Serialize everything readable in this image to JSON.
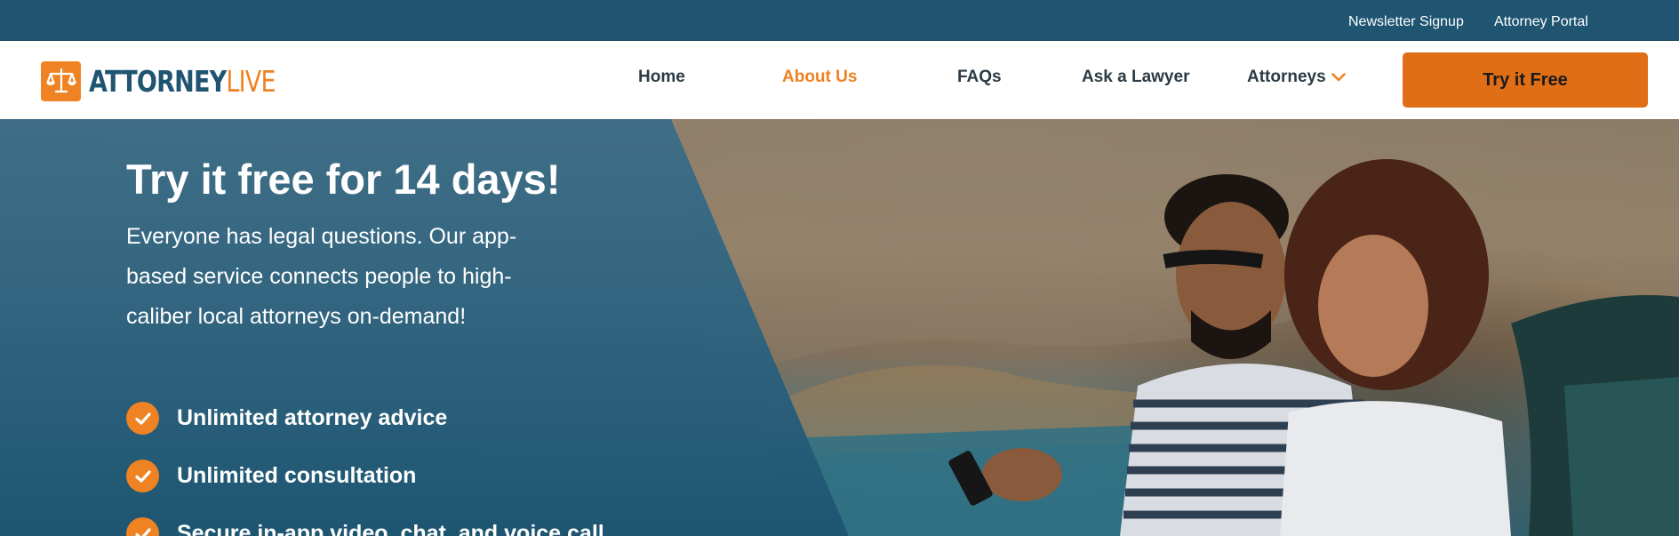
{
  "utility_nav": {
    "newsletter": "Newsletter Signup",
    "portal": "Attorney Portal"
  },
  "brand": {
    "word1": "ATTORNEY",
    "word2": "LIVE",
    "logo_icon": "scales-of-justice-icon"
  },
  "nav": {
    "home": "Home",
    "about": "About Us",
    "faqs": "FAQs",
    "ask": "Ask a Lawyer",
    "attorneys": "Attorneys",
    "active": "About Us"
  },
  "cta": {
    "label": "Try it Free"
  },
  "hero": {
    "title": "Try it free for 14 days!",
    "subtitle": "Everyone has legal questions. Our app-based service connects people to high-caliber local attorneys on-demand!",
    "features": [
      "Unlimited attorney advice",
      "Unlimited consultation",
      "Secure in-app video, chat, and voice call"
    ],
    "feature_icon": "checkmark-circle-icon",
    "image": "couple-looking-at-phone-by-car-on-coast"
  },
  "colors": {
    "brand_navy": "#1f5571",
    "brand_orange": "#ef8222",
    "cta_orange": "#e06e16"
  }
}
